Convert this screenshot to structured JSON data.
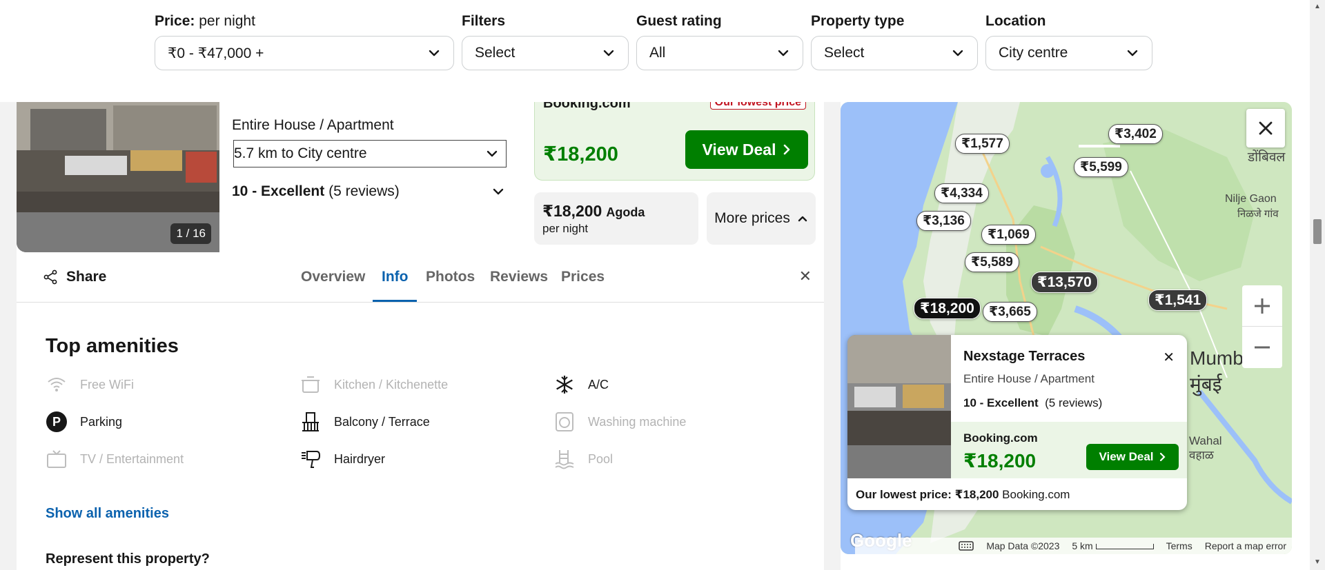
{
  "filters": {
    "price_label": "Price:",
    "price_sub": "per night",
    "price_value": "₹0 - ₹47,000 +",
    "filters_label": "Filters",
    "filters_value": "Select",
    "guest_rating_label": "Guest rating",
    "guest_rating_value": "All",
    "property_type_label": "Property type",
    "property_type_value": "Select",
    "location_label": "Location",
    "location_value": "City centre"
  },
  "listing": {
    "photo_counter": "1 / 16",
    "property_type": "Entire House / Apartment",
    "distance": "5.7 km to City centre",
    "rating_score": "10 - Excellent",
    "rating_reviews": "(5 reviews)",
    "deal_provider": "Booking.com",
    "lowest_badge": "Our lowest price",
    "deal_price": "₹18,200",
    "view_deal": "View Deal",
    "alt_price": "₹18,200",
    "alt_provider": "Agoda",
    "alt_per_night": "per night",
    "more_prices": "More prices"
  },
  "tabs": {
    "share": "Share",
    "items": [
      "Overview",
      "Info",
      "Photos",
      "Reviews",
      "Prices"
    ],
    "active": "Info"
  },
  "amenities": {
    "title": "Top amenities",
    "items": [
      {
        "label": "Free WiFi",
        "available": false,
        "icon": "wifi-icon"
      },
      {
        "label": "Kitchen / Kitchenette",
        "available": false,
        "icon": "kitchen-icon"
      },
      {
        "label": "A/C",
        "available": true,
        "icon": "snowflake-icon"
      },
      {
        "label": "Parking",
        "available": true,
        "icon": "parking-icon"
      },
      {
        "label": "Balcony / Terrace",
        "available": true,
        "icon": "balcony-icon"
      },
      {
        "label": "Washing machine",
        "available": false,
        "icon": "washing-machine-icon"
      },
      {
        "label": "TV / Entertainment",
        "available": false,
        "icon": "tv-icon"
      },
      {
        "label": "Hairdryer",
        "available": true,
        "icon": "hairdryer-icon"
      },
      {
        "label": "Pool",
        "available": false,
        "icon": "pool-icon"
      }
    ],
    "show_all": "Show all amenities",
    "represent": "Represent this property?"
  },
  "map": {
    "pins": [
      "₹1,577",
      "₹3,402",
      "₹5,599",
      "₹4,334",
      "₹3,136",
      "₹1,069",
      "₹5,589",
      "₹13,570",
      "₹1,541",
      "₹3,665",
      "₹18,200"
    ],
    "labels": {
      "nilje": "Nilje Gaon",
      "nilje_local": "निळजे गांव",
      "mumbai": "Mumb",
      "mumbai_local": "मुंबई",
      "wahal": "Wahal",
      "wahal_local": "वहाळ",
      "dombivli": "डोंबिवल"
    },
    "card": {
      "name": "Nexstage Terraces",
      "type": "Entire House / Apartment",
      "rating_score": "10 - Excellent",
      "rating_reviews": "(5 reviews)",
      "provider": "Booking.com",
      "price": "₹18,200",
      "view_deal": "View Deal",
      "lowest_label": "Our lowest price:",
      "lowest_price": "₹18,200",
      "lowest_provider": "Booking.com"
    },
    "footer": {
      "map_data": "Map Data ©2023",
      "scale": "5 km",
      "terms": "Terms",
      "report": "Report a map error"
    },
    "google": "Google"
  },
  "colors": {
    "accent_blue": "#0b62ae",
    "deal_green": "#007f00",
    "lowest_red": "#c1121f"
  }
}
